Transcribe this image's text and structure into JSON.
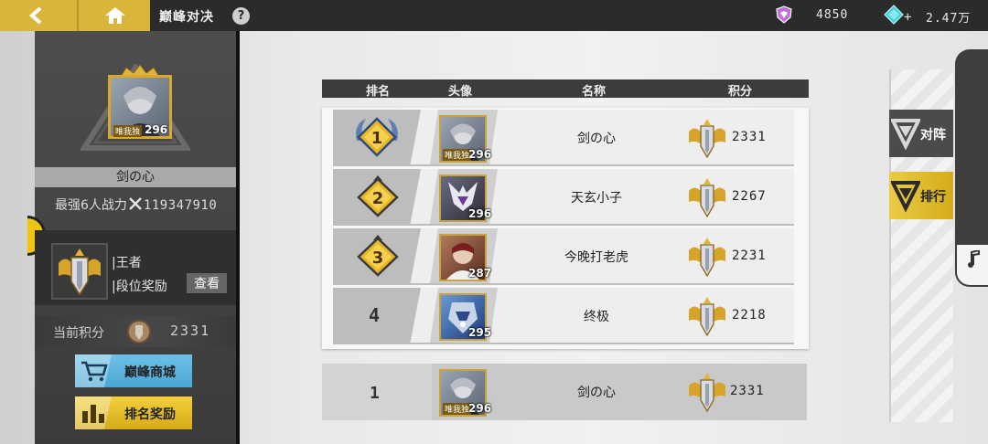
{
  "topbar": {
    "title": "巅峰对决",
    "help": "?",
    "currency_1": "4850",
    "currency_2_plus": "+",
    "currency_2": "2.47万"
  },
  "profile": {
    "avatar_level": "296",
    "avatar_tag": "唯我独",
    "name": "剑の心",
    "power_label": "最强6人战力",
    "power_value": "119347910",
    "rank_title": "|王者",
    "rank_reward": "|段位奖励",
    "view_label": "查看",
    "score_label": "当前积分",
    "score_value": "2331",
    "shop_label": "巅峰商城",
    "reward_label": "排名奖励"
  },
  "table": {
    "headers": [
      "排名",
      "头像",
      "名称",
      "积分"
    ],
    "rows": [
      {
        "rank": "1",
        "level": "296",
        "tag": "唯我独",
        "name": "剑の心",
        "score": "2331",
        "portrait_color": "#8e9aa8"
      },
      {
        "rank": "2",
        "level": "296",
        "tag": "",
        "name": "天玄小子",
        "score": "2267",
        "portrait_color": "#5b5b6e"
      },
      {
        "rank": "3",
        "level": "287",
        "tag": "",
        "name": "今晚打老虎",
        "score": "2231",
        "portrait_color": "#8a5a4a"
      },
      {
        "rank": "4",
        "level": "295",
        "tag": "",
        "name": "终极",
        "score": "2218",
        "portrait_color": "#3f6fb0"
      }
    ],
    "self_row": {
      "rank": "1",
      "level": "296",
      "tag": "唯我独",
      "name": "剑の心",
      "score": "2331"
    }
  },
  "side_nav": {
    "battle_label": "对阵",
    "rank_label": "排行"
  },
  "colors": {
    "accent_gold": "#d9b63b",
    "topbar_bg": "#2b2b2b",
    "shop_blue": "#4aa6d4"
  }
}
